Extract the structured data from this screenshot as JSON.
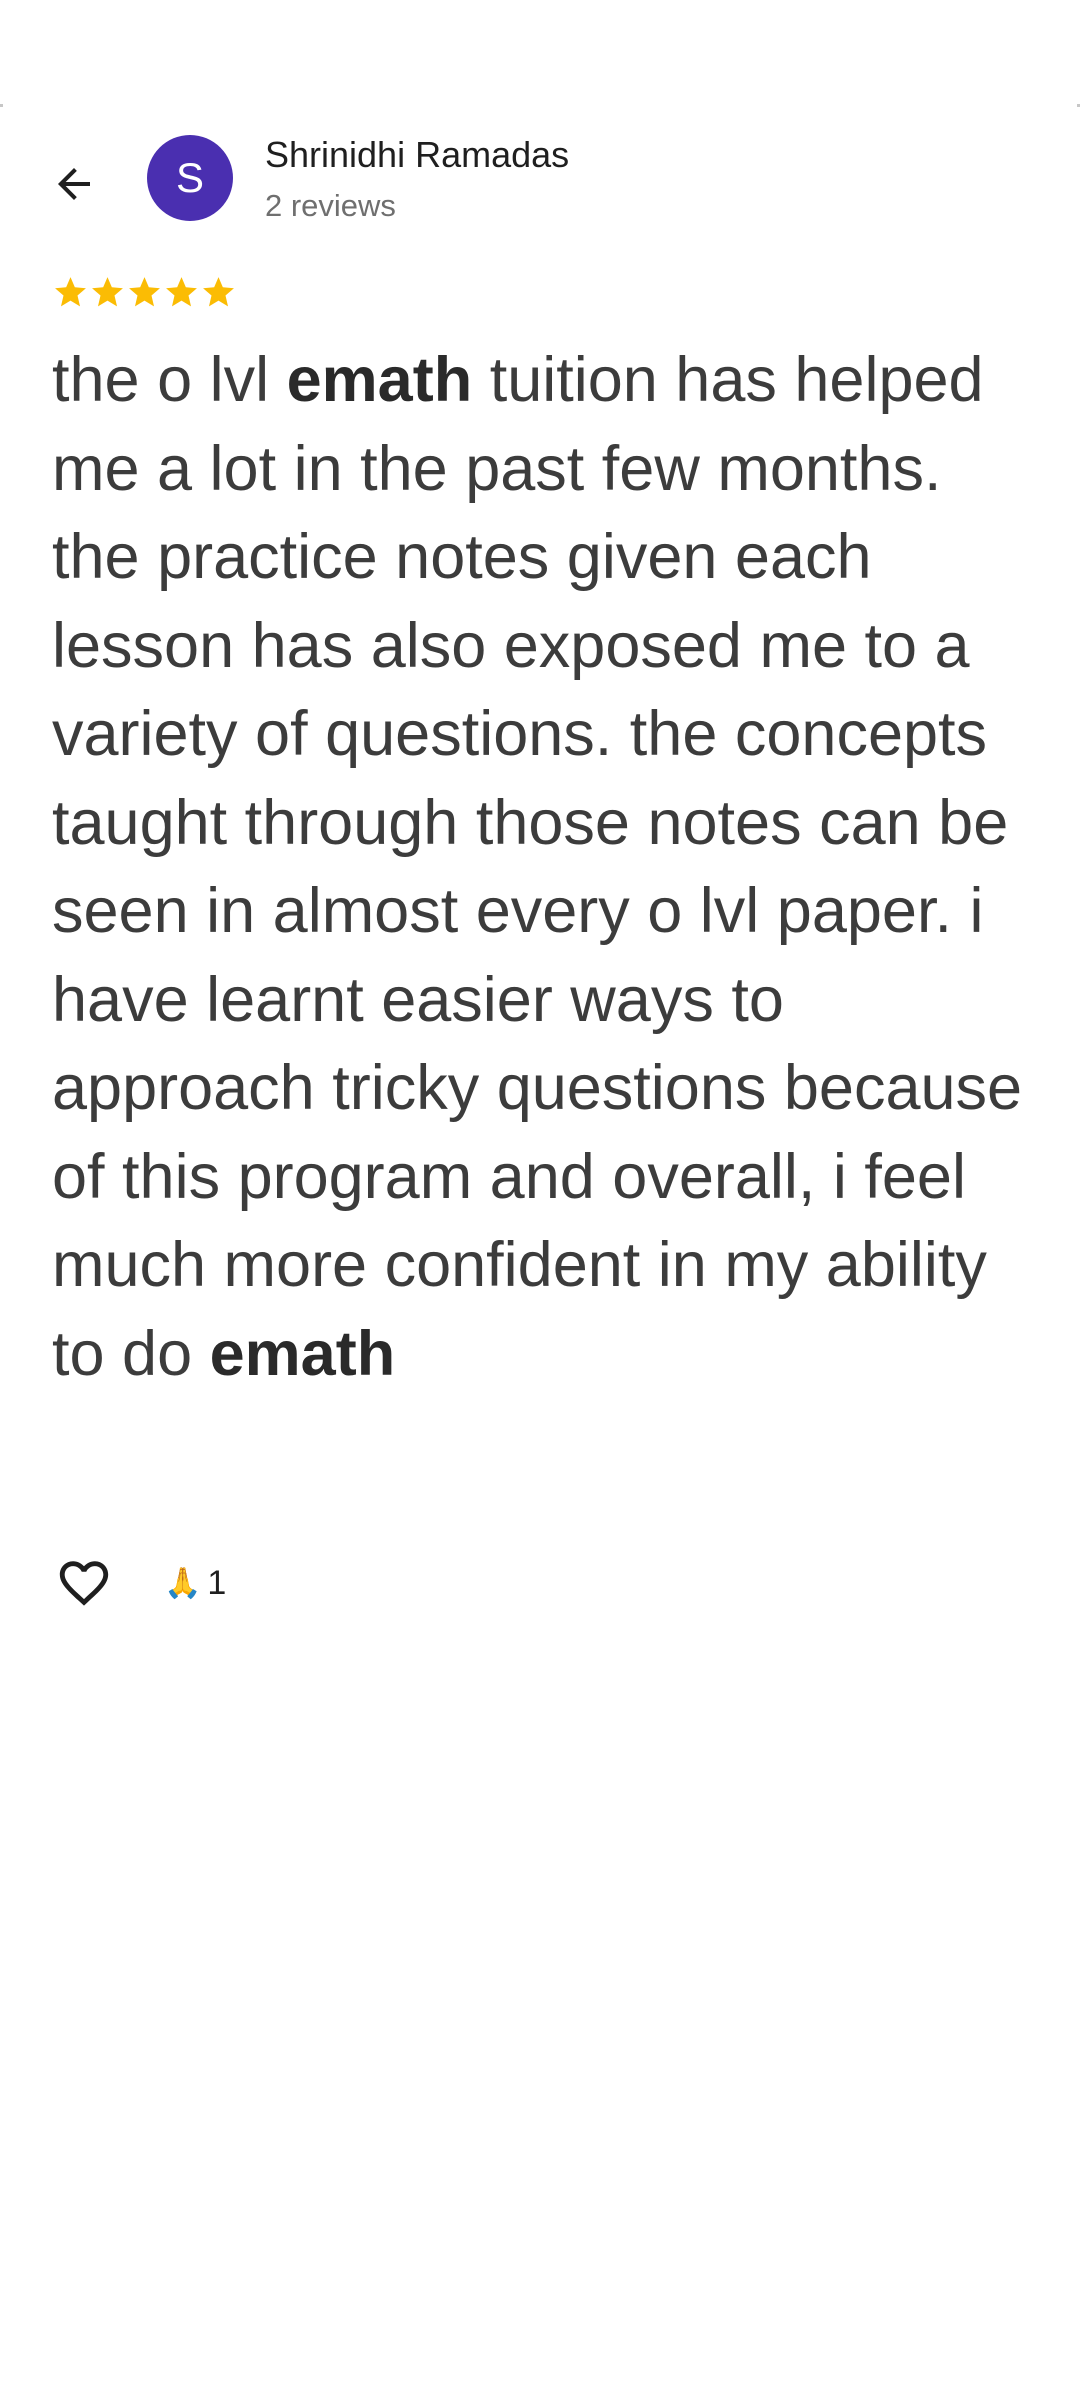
{
  "header": {
    "back_icon": "arrow-back-icon",
    "avatar_letter": "S",
    "avatar_color": "#4a2fb0",
    "author_name": "Shrinidhi Ramadas",
    "author_meta": "2 reviews"
  },
  "review": {
    "rating": 5,
    "rating_max": 5,
    "star_color": "#fbbc04",
    "text_parts": [
      {
        "text": "the o lvl ",
        "bold": false
      },
      {
        "text": "emath",
        "bold": true
      },
      {
        "text": " tuition has helped me a lot in the past few months. the practice notes given each lesson has also exposed me to a variety of questions. the concepts taught through those notes can be seen in almost every o lvl paper. i have learnt easier ways to approach tricky questions because of this program and overall, i feel much more confident in my ability to do ",
        "bold": false
      },
      {
        "text": "emath",
        "bold": true
      }
    ]
  },
  "actions": {
    "like_icon": "heart-outline-icon",
    "reaction_icon": "folded-hands-icon",
    "reaction_emoji": "🙏",
    "reaction_count": "1"
  }
}
